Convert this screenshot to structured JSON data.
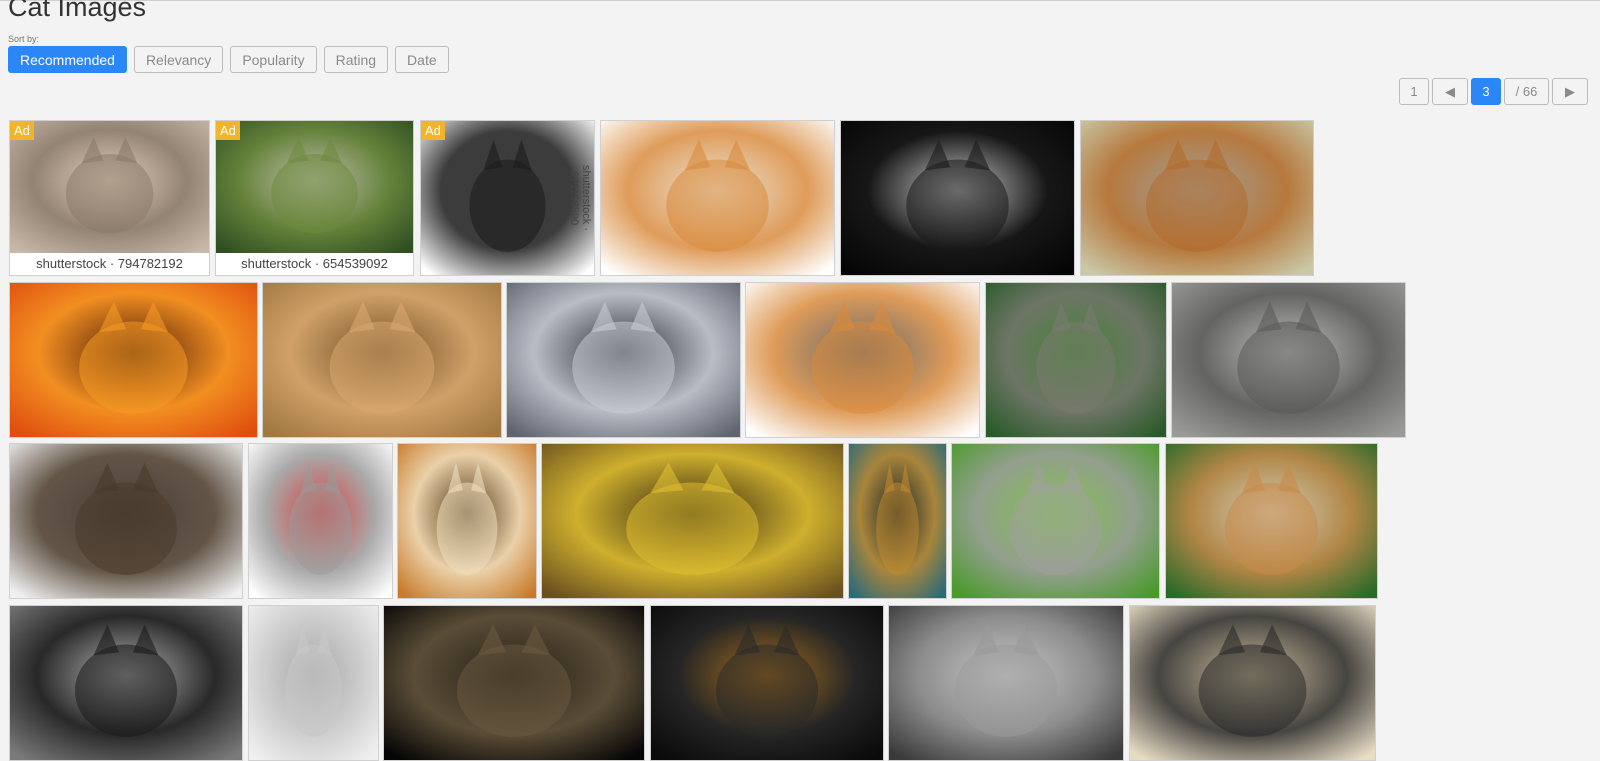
{
  "page": {
    "title": "Cat Images"
  },
  "sort": {
    "label": "Sort by:",
    "options": [
      "Recommended",
      "Relevancy",
      "Popularity",
      "Rating",
      "Date"
    ],
    "active": "Recommended"
  },
  "pagination": {
    "first": "1",
    "prev_symbol": "◀",
    "current": "3",
    "total": "/ 66",
    "next_symbol": "▶"
  },
  "ad_label": "Ad",
  "images": [
    {
      "name": "ad-surprised-cat",
      "ad": true,
      "caption": "shutterstock · 794782192",
      "colors": [
        "#c7b8a8",
        "#8a7a6a",
        "#e8d2c0"
      ]
    },
    {
      "name": "ad-kitten-and-puppy",
      "ad": true,
      "caption": "shutterstock · 654539092",
      "colors": [
        "#2f4f22",
        "#6e8a3e",
        "#d8d2c6"
      ]
    },
    {
      "name": "ad-dog-cat-silhouette",
      "ad": true,
      "caption": "shutterstock · 671156590",
      "vertical": true,
      "colors": [
        "#ffffff",
        "#1a1a1a",
        "#1a1a1a"
      ]
    },
    {
      "name": "kitten-watering-can",
      "colors": [
        "#ffffff",
        "#d98a3c",
        "#e8e0d0"
      ]
    },
    {
      "name": "black-white-cat",
      "colors": [
        "#050505",
        "#1a1a1a",
        "#f0f0f0"
      ]
    },
    {
      "name": "resting-tiger",
      "colors": [
        "#c9c9a8",
        "#b36a2a",
        "#9a9a9a"
      ]
    },
    {
      "name": "lion-sunset",
      "colors": [
        "#e04e0e",
        "#f59a25",
        "#3a1a08"
      ]
    },
    {
      "name": "cat-fishbowl-art",
      "colors": [
        "#a07840",
        "#d9a870",
        "#6a4a20"
      ]
    },
    {
      "name": "bw-cat-closeup",
      "colors": [
        "#606470",
        "#c8ccd4",
        "#20242c"
      ]
    },
    {
      "name": "kitten-in-shoe",
      "colors": [
        "#ffffff",
        "#d98a3c",
        "#505050"
      ]
    },
    {
      "name": "pallas-cat",
      "colors": [
        "#2a5a2a",
        "#7a7a70",
        "#4a8a3a"
      ]
    },
    {
      "name": "tabby-face",
      "colors": [
        "#9a9a98",
        "#5a5a58",
        "#c8c8c6"
      ]
    },
    {
      "name": "kitten-in-chest",
      "colors": [
        "#f0f0f0",
        "#4a3a2a",
        "#2a2018"
      ]
    },
    {
      "name": "cartoon-gray-cat",
      "colors": [
        "#ffffff",
        "#9a9a9a",
        "#d02020"
      ]
    },
    {
      "name": "tiger-face",
      "colors": [
        "#c87a2a",
        "#f0e0c0",
        "#3a2a10"
      ]
    },
    {
      "name": "fractal-cat-eyes",
      "colors": [
        "#6a5020",
        "#e0c030",
        "#2a2010"
      ]
    },
    {
      "name": "halloween-cat-card",
      "colors": [
        "#2a6a7a",
        "#c08a30",
        "#1a1a1a"
      ]
    },
    {
      "name": "kitten-in-grass",
      "colors": [
        "#4a9a2a",
        "#a0a0a0",
        "#8ac850"
      ]
    },
    {
      "name": "yawning-lynx",
      "colors": [
        "#2a6a2a",
        "#c88a4a",
        "#f0e0d0"
      ]
    },
    {
      "name": "black-cat-cone",
      "colors": [
        "#7a7a7a",
        "#1a1a1a",
        "#c0c0c0"
      ]
    },
    {
      "name": "sketch-cat-flowers",
      "colors": [
        "#f0f0f0",
        "#c8c8c8",
        "#9a9a9a"
      ]
    },
    {
      "name": "tabby-on-black",
      "colors": [
        "#050505",
        "#6a5a40",
        "#2a2418"
      ]
    },
    {
      "name": "black-fluffy-cat",
      "colors": [
        "#0a0a0a",
        "#2a2a2a",
        "#c08020"
      ]
    },
    {
      "name": "gray-cat-closeup",
      "colors": [
        "#3a3a3a",
        "#9a9a9a",
        "#e0e0e0"
      ]
    },
    {
      "name": "halloween-vintage-sketch",
      "colors": [
        "#e8dcc4",
        "#2a2a2a",
        "#c8b894"
      ]
    }
  ]
}
